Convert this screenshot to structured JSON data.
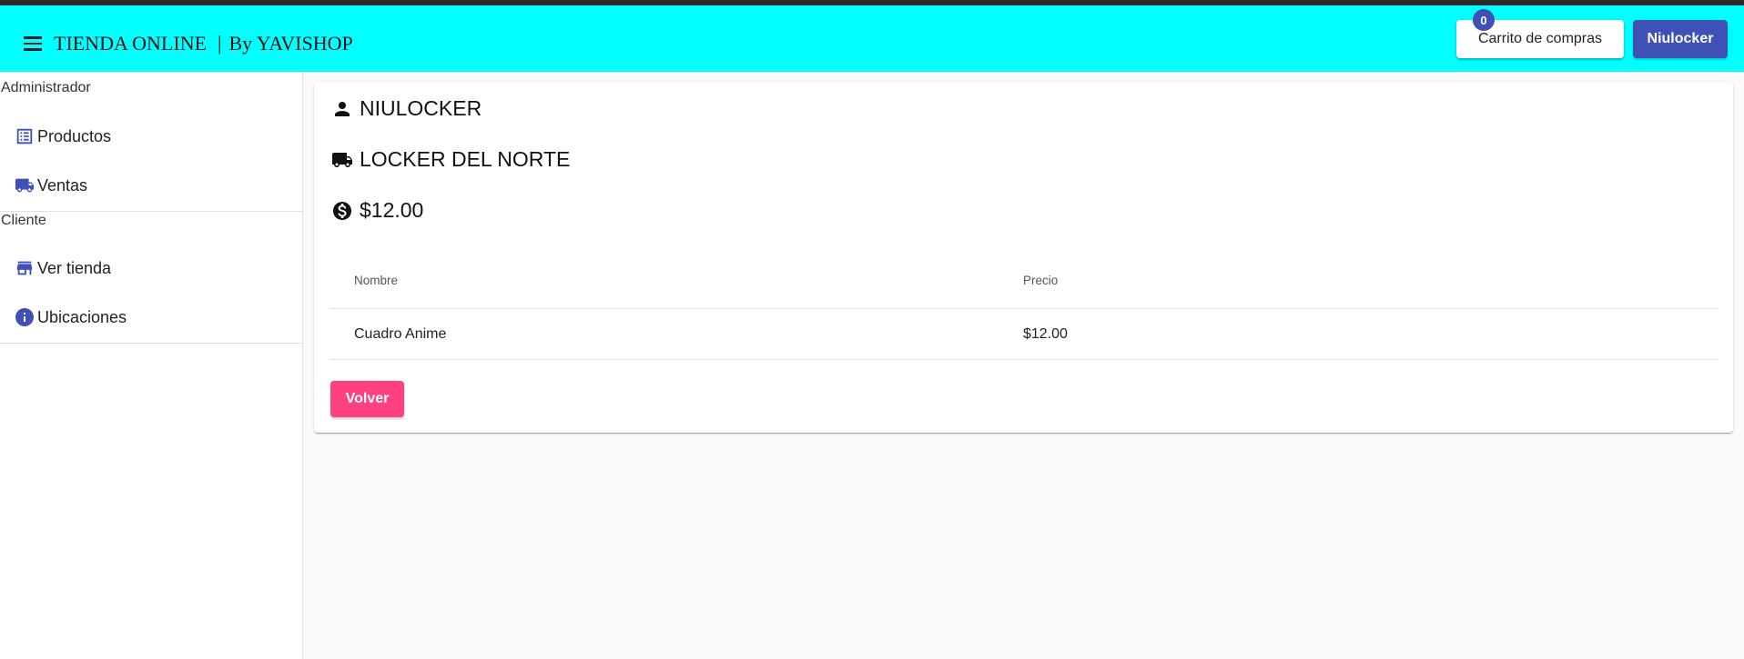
{
  "header": {
    "brand": "TIENDA ONLINE",
    "brand_separator": "|",
    "brand_suffix": "By YAVISHOP",
    "cart_label": "Carrito de compras",
    "cart_count": "0",
    "user_label": "Niulocker",
    "accent_color": "#00ffff",
    "primary_color": "#3f51b5"
  },
  "sidebar": {
    "sections": [
      {
        "title": "Administrador",
        "items": [
          {
            "label": "Productos",
            "icon": "list-alt-icon"
          },
          {
            "label": "Ventas",
            "icon": "local-shipping-icon"
          }
        ]
      },
      {
        "title": "Cliente",
        "items": [
          {
            "label": "Ver tienda",
            "icon": "store-icon"
          },
          {
            "label": "Ubicaciones",
            "icon": "info-icon"
          }
        ]
      }
    ]
  },
  "order": {
    "customer": "NIULOCKER",
    "location": "LOCKER DEL NORTE",
    "total": "$12.00",
    "table": {
      "columns": [
        "Nombre",
        "Precio"
      ],
      "rows": [
        [
          "Cuadro Anime",
          "$12.00"
        ]
      ]
    },
    "back_label": "Volver",
    "back_color": "#ff4081"
  }
}
